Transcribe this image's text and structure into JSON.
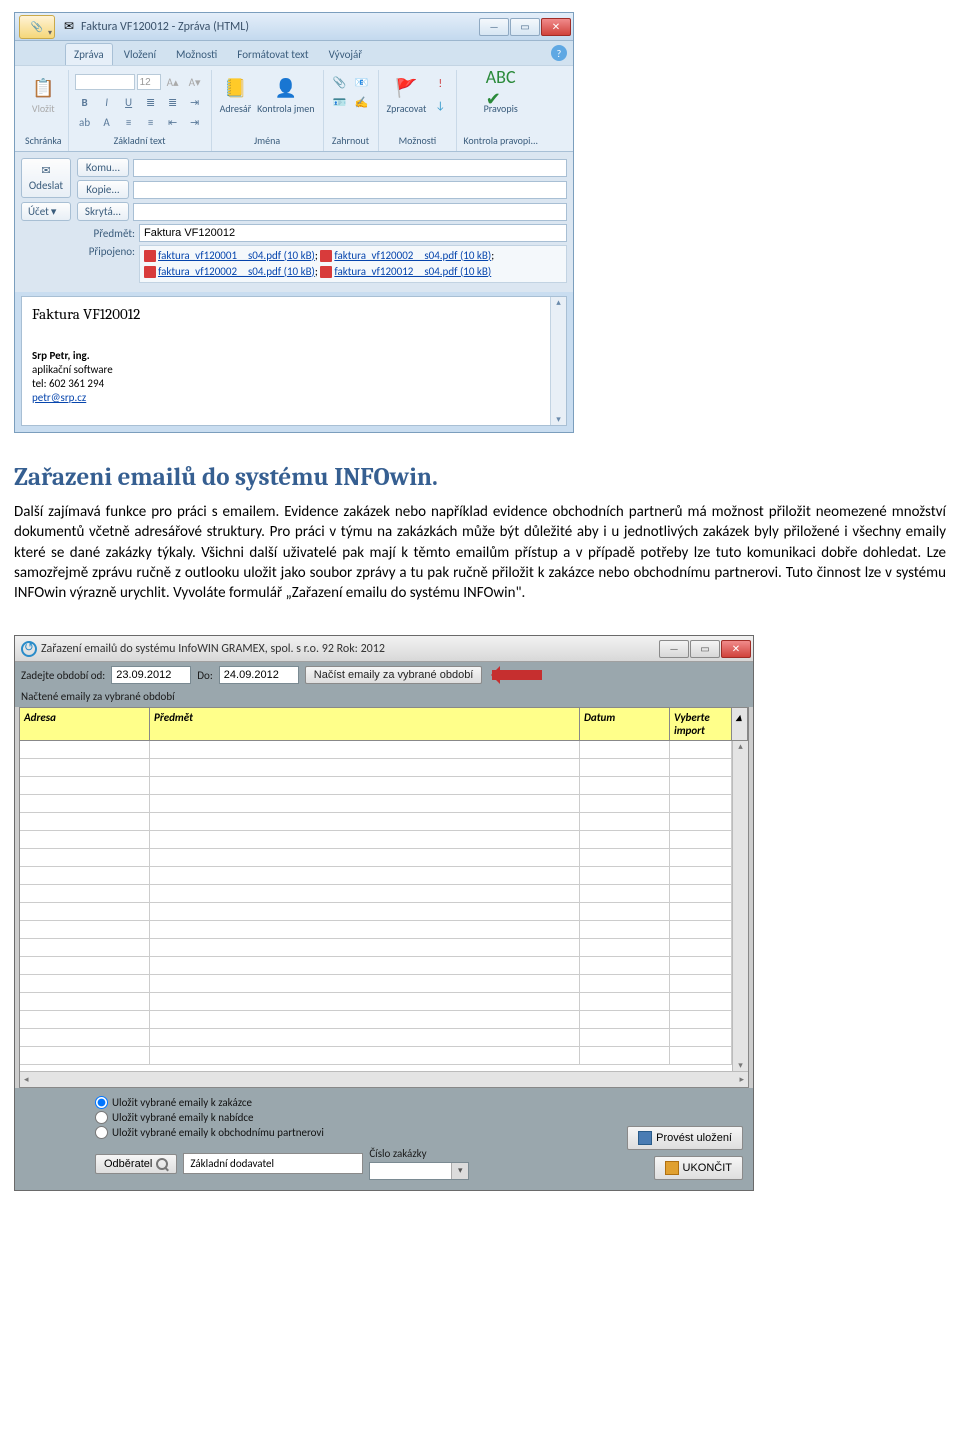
{
  "outlook": {
    "window_title": "Faktura VF120012   -  Zpráva (HTML)",
    "tabs": [
      "Zpráva",
      "Vložení",
      "Možnosti",
      "Formátovat text",
      "Vývojář"
    ],
    "ribbon_groups": {
      "clipboard": {
        "paste": "Vložit",
        "label": "Schránka"
      },
      "font": {
        "font_size": "12",
        "label": "Základní text"
      },
      "names": {
        "addressbook": "Adresář",
        "checknames": "Kontrola jmen",
        "label": "Jména"
      },
      "include": {
        "label": "Zahrnout"
      },
      "options": {
        "followup": "Zpracovat",
        "label": "Možnosti"
      },
      "proofing": {
        "spelling": "Pravopis",
        "label": "Kontrola pravopi..."
      }
    },
    "compose": {
      "send": "Odeslat",
      "account": "Účet",
      "to": "Komu...",
      "cc": "Kopie...",
      "bcc": "Skrytá...",
      "subject_lbl": "Předmět:",
      "subject_val": "Faktura VF120012",
      "attached_lbl": "Připojeno:",
      "attachments": [
        "faktura_vf120001__s04.pdf (10 kB)",
        "faktura_vf120002__s04.pdf (10 kB)",
        "faktura_vf120002__s04.pdf (10 kB)",
        "faktura_vf120012__s04.pdf (10 kB)"
      ]
    },
    "body": {
      "title": "Faktura VF120012",
      "sig_name": "Srp Petr, ing.",
      "sig_l1": "aplikační software",
      "sig_l2": "tel: 602 361 294",
      "sig_mail": "petr@srp.cz"
    }
  },
  "article": {
    "heading": "Zařazeni emailů do systému INFOwin.",
    "body": "Další zajímavá funkce pro práci s emailem. Evidence zakázek nebo například evidence obchodních partnerů má možnost přiložit neomezené množství dokumentů včetně adresářové struktury. Pro práci v týmu na zakázkách může být důležité aby i u jednotlivých zakázek byly přiložené i všechny emaily které se dané zakázky týkaly. Všichni další uživatelé pak mají k těmto emailům přístup a v případě potřeby lze tuto komunikaci dobře dohledat. Lze samozřejmě zprávu ručně z outlooku uložit jako soubor zprávy a tu pak ručně přiložit k zakázce nebo obchodnímu partnerovi. Tuto činnost lze v systému INFOwin výrazně urychlit. Vyvoláte formulář „Zařazení emailu do systému INFOwin\"."
  },
  "infowin": {
    "title": "Zařazení emailů do systému InfoWIN  GRAMEX, spol. s r.o.        92  Rok: 2012",
    "period_from_lbl": "Zadejte období od:",
    "period_from": "23.09.2012",
    "period_to_lbl": "Do:",
    "period_to": "24.09.2012",
    "load_btn": "Načíst emaily za vybrané období",
    "grid_label": "Načtené emaily za vybrané období",
    "cols": {
      "addr": "Adresa",
      "subj": "Předmět",
      "date": "Datum",
      "imp": "Vyberte import"
    },
    "radios": [
      "Uložit vybrané emaily k zakázce",
      "Uložit vybrané emaily k nabídce",
      "Uložit vybrané emaily k obchodnímu partnerovi"
    ],
    "lookup_btn": "Odběratel",
    "lookup_val": "Základní dodavatel",
    "zak_lbl": "Číslo zakázky",
    "save_btn": "Provést uložení",
    "exit_btn": "UKONČIT"
  }
}
